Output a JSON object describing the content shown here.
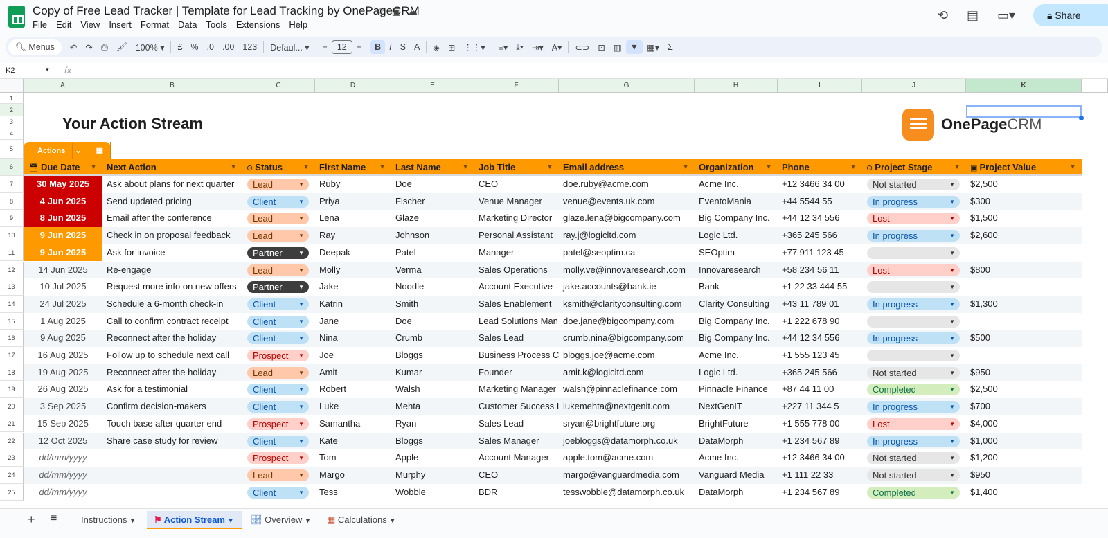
{
  "app": {
    "title": "Copy of Free Lead Tracker | Template for Lead Tracking by OnePageCRM",
    "menu": [
      "File",
      "Edit",
      "View",
      "Insert",
      "Format",
      "Data",
      "Tools",
      "Extensions",
      "Help"
    ],
    "share_label": "Share"
  },
  "toolbar": {
    "menus": "Menus",
    "zoom": "100%",
    "currency": "£",
    "percent": "%",
    "dec_less": ".0",
    "dec_more": ".00",
    "format123": "123",
    "font": "Defaul...",
    "font_size": "12",
    "bold": "B",
    "italic": "I"
  },
  "formula_bar": {
    "cell_ref": "K2",
    "fx": "fx"
  },
  "columns": [
    "A",
    "B",
    "C",
    "D",
    "E",
    "F",
    "G",
    "H",
    "I",
    "J",
    "K"
  ],
  "sheet": {
    "title": "Your Action Stream",
    "brand": "OnePageCRM",
    "brand_bold": "OnePage",
    "brand_light": "CRM",
    "table_tab": "Actions",
    "headers": [
      "Due Date",
      "Next Action",
      "Status",
      "First Name",
      "Last Name",
      "Job Title",
      "Email address",
      "Organization",
      "Phone",
      "Project Stage",
      "Project Value"
    ],
    "rows": [
      [
        "30 May 2025",
        "Ask about plans for next quarter",
        "Lead",
        "Ruby",
        "Doe",
        "CEO",
        "doe.ruby@acme.com",
        "Acme Inc.",
        "+12 3466 34 00",
        "Not started",
        "$2,500",
        "overdue"
      ],
      [
        "4 Jun 2025",
        "Send updated pricing",
        "Client",
        "Priya",
        "Fischer",
        "Venue Manager",
        "venue@events.uk.com",
        "EventoMania",
        "+44 5544 55",
        "In progress",
        "$300",
        "overdue"
      ],
      [
        "8 Jun 2025",
        "Email after the conference",
        "Lead",
        "Lena",
        "Glaze",
        "Marketing Director",
        "glaze.lena@bigcompany.com",
        "Big Company Inc.",
        "+44 12 34 556",
        "Lost",
        "$1,500",
        "overdue"
      ],
      [
        "9 Jun 2025",
        "Check in on proposal feedback",
        "Lead",
        "Ray",
        "Johnson",
        "Personal Assistant",
        "ray.j@logicltd.com",
        "Logic Ltd.",
        "+365 245 566",
        "In progress",
        "$2,600",
        "due"
      ],
      [
        "9 Jun 2025",
        "Ask for invoice",
        "Partner",
        "Deepak",
        "Patel",
        "Manager",
        "patel@seoptim.ca",
        "SEOptim",
        "+77 911 123 45",
        "",
        "",
        "due"
      ],
      [
        "14 Jun 2025",
        "Re-engage",
        "Lead",
        "Molly",
        "Verma",
        "Sales Operations",
        "molly.ve@innovaresearch.com",
        "Innovaresearch",
        "+58 234 56 11",
        "Lost",
        "$800",
        ""
      ],
      [
        "10 Jul 2025",
        "Request more info on new offers",
        "Partner",
        "Jake",
        "Noodle",
        "Account Executive",
        "jake.accounts@bank.ie",
        "Bank",
        "+1 22 33 444 55",
        "",
        "",
        ""
      ],
      [
        "24 Jul 2025",
        "Schedule a 6-month check-in",
        "Client",
        "Katrin",
        "Smith",
        "Sales Enablement",
        "ksmith@clarityconsulting.com",
        "Clarity Consulting",
        "+43 11 789 01",
        "In progress",
        "$1,300",
        ""
      ],
      [
        "1 Aug 2025",
        "Call to confirm contract receipt",
        "Client",
        "Jane",
        "Doe",
        "Lead Solutions Man",
        "doe.jane@bigcompany.com",
        "Big Company Inc.",
        "+1 222 678 90",
        "",
        "",
        ""
      ],
      [
        "9 Aug 2025",
        "Reconnect after the holiday",
        "Client",
        "Nina",
        "Crumb",
        "Sales Lead",
        "crumb.nina@bigcompany.com",
        "Big Company Inc.",
        "+44 12 34 556",
        "In progress",
        "$500",
        ""
      ],
      [
        "16 Aug 2025",
        "Follow up to schedule next call",
        "Prospect",
        "Joe",
        "Bloggs",
        "Business Process C",
        "bloggs.joe@acme.com",
        "Acme Inc.",
        "+1 555 123 45",
        "",
        "",
        ""
      ],
      [
        "19 Aug 2025",
        "Reconnect after the holiday",
        "Lead",
        "Amit",
        "Kumar",
        "Founder",
        "amit.k@logicltd.com",
        "Logic Ltd.",
        "+365 245 566",
        "Not started",
        "$950",
        ""
      ],
      [
        "26 Aug 2025",
        "Ask for a testimonial",
        "Client",
        "Robert",
        "Walsh",
        "Marketing Manager",
        "walsh@pinnaclefinance.com",
        "Pinnacle Finance",
        "+87 44 11 00",
        "Completed",
        "$2,500",
        ""
      ],
      [
        "3 Sep 2025",
        "Confirm decision-makers",
        "Client",
        "Luke",
        "Mehta",
        "Customer Success I",
        "lukemehta@nextgenit.com",
        "NextGenIT",
        "+227 11 344 5",
        "In progress",
        "$700",
        ""
      ],
      [
        "15 Sep 2025",
        "Touch base after quarter end",
        "Prospect",
        "Samantha",
        "Ryan",
        "Sales Lead",
        "sryan@brightfuture.org",
        "BrightFuture",
        "+1 555 778 00",
        "Lost",
        "$4,000",
        ""
      ],
      [
        "12 Oct 2025",
        "Share case study for review",
        "Client",
        "Kate",
        "Bloggs",
        "Sales Manager",
        "joebloggs@datamorph.co.uk",
        "DataMorph",
        "+1 234 567 89",
        "In progress",
        "$1,000",
        ""
      ],
      [
        "dd/mm/yyyy",
        "",
        "Prospect",
        "Tom",
        "Apple",
        "Account Manager",
        "apple.tom@acme.com",
        "Acme Inc.",
        "+12 3466 34 00",
        "Not started",
        "$1,200",
        "placeholder"
      ],
      [
        "dd/mm/yyyy",
        "",
        "Lead",
        "Margo",
        "Murphy",
        "CEO",
        "margo@vanguardmedia.com",
        "Vanguard Media",
        "+1 111 22 33",
        "Not started",
        "$950",
        "placeholder"
      ],
      [
        "dd/mm/yyyy",
        "",
        "Client",
        "Tess",
        "Wobble",
        "BDR",
        "tesswobble@datamorph.co.uk",
        "DataMorph",
        "+1 234 567 89",
        "Completed",
        "$1,400",
        "placeholder"
      ]
    ]
  },
  "colors": {
    "overdue": "#cc0000",
    "due": "#ff9900",
    "header": "#ff9900",
    "Lead": "#ffc8aa",
    "Client": "#bfe1f6",
    "Partner": "#3d3d3d",
    "Prospect": "#ffcfc9",
    "Not started": "#e6e6e6",
    "In progress": "#bfe1f6",
    "Lost": "#ffcfc9",
    "Completed": "#d4edbc",
    "empty": "#e6e6e6"
  },
  "tabs": [
    {
      "label": "Instructions",
      "icon": ""
    },
    {
      "label": "Action Stream",
      "icon": "flag-icon",
      "active": true
    },
    {
      "label": "Overview",
      "icon": "chart-icon"
    },
    {
      "label": "Calculations",
      "icon": "calculator-icon"
    }
  ]
}
